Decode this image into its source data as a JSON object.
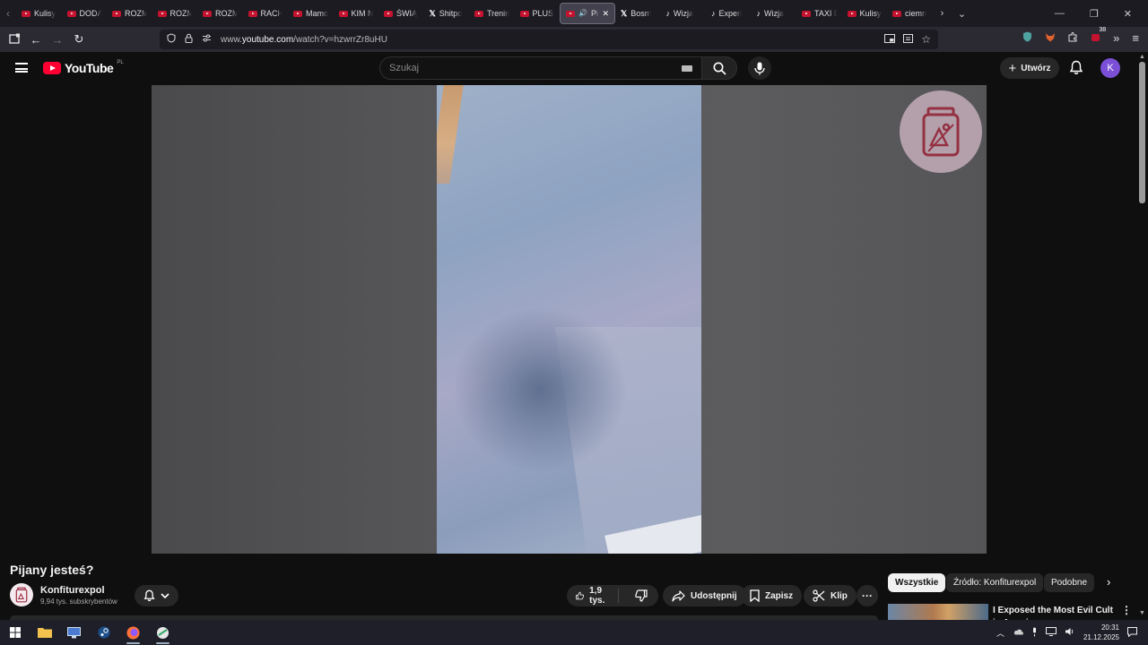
{
  "browser": {
    "tabs": [
      {
        "label": "Kulisy",
        "icon": "youtube-icon"
      },
      {
        "label": "DODA",
        "icon": "youtube-icon"
      },
      {
        "label": "ROZM",
        "icon": "youtube-icon"
      },
      {
        "label": "ROZM",
        "icon": "youtube-icon"
      },
      {
        "label": "ROZM",
        "icon": "youtube-icon"
      },
      {
        "label": "RACH",
        "icon": "youtube-icon"
      },
      {
        "label": "Mamo",
        "icon": "youtube-icon"
      },
      {
        "label": "KIM N",
        "icon": "youtube-icon"
      },
      {
        "label": "ŚWIĄ",
        "icon": "youtube-icon"
      },
      {
        "label": "Shitpo",
        "icon": "x-icon"
      },
      {
        "label": "Trenin",
        "icon": "youtube-icon"
      },
      {
        "label": "PLUSH",
        "icon": "youtube-icon"
      },
      {
        "label": "Pija",
        "icon": "youtube-icon",
        "active": true
      },
      {
        "label": "Bosm",
        "icon": "x-icon"
      },
      {
        "label": "Wizja",
        "icon": "tiktok-icon"
      },
      {
        "label": "Experi",
        "icon": "tiktok-icon"
      },
      {
        "label": "Wizja",
        "icon": "tiktok-icon"
      },
      {
        "label": "TAXI B",
        "icon": "youtube-icon"
      },
      {
        "label": "Kulisy",
        "icon": "youtube-icon"
      },
      {
        "label": "ciemn",
        "icon": "youtube-icon"
      }
    ],
    "url_prefix": "www.",
    "url_host": "youtube.com",
    "url_path": "/watch?v=hzwrrZr8uHU",
    "extension_badge": "38"
  },
  "youtube": {
    "logo_text": "YouTube",
    "country_code": "PL",
    "search_placeholder": "Szukaj",
    "create_label": "Utwórz",
    "avatar_letter": "K"
  },
  "video": {
    "title": "Pijany jesteś?",
    "channel_name": "Konfiturexpol",
    "subscribers": "9,94 tys. subskrybentów",
    "likes": "1,9 tys.",
    "share_label": "Udostępnij",
    "save_label": "Zapisz",
    "clip_label": "Klip"
  },
  "sidebar": {
    "chips": [
      "Wszystkie",
      "Źródło: Konfiturexpol",
      "Podobne"
    ],
    "recommended_title": "I Exposed the Most Evil Cult in America"
  },
  "taskbar": {
    "time": "20:31",
    "date": "21.12.2025"
  }
}
